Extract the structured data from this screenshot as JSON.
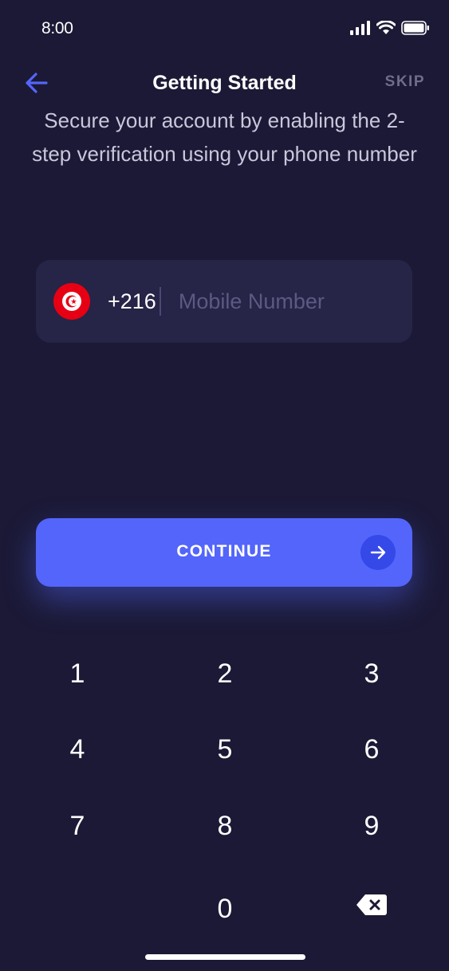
{
  "status_bar": {
    "time": "8:00"
  },
  "header": {
    "title": "Getting Started",
    "skip_label": "SKIP",
    "back_icon": "arrow-left-icon"
  },
  "subtitle": "Secure your account by enabling the 2-step verification using your phone number",
  "phone": {
    "country_flag": "tunisia-flag-icon",
    "country_code": "+216",
    "value": "",
    "placeholder": "Mobile Number"
  },
  "continue": {
    "label": "CONTINUE",
    "icon": "arrow-right-icon"
  },
  "keypad": {
    "keys": [
      "1",
      "2",
      "3",
      "4",
      "5",
      "6",
      "7",
      "8",
      "9",
      "0"
    ],
    "delete_icon": "backspace-icon"
  },
  "colors": {
    "background": "#1b1935",
    "field": "#262447",
    "accent": "#5365fb",
    "back_arrow": "#5365fb",
    "muted": "#6f6c8c"
  }
}
